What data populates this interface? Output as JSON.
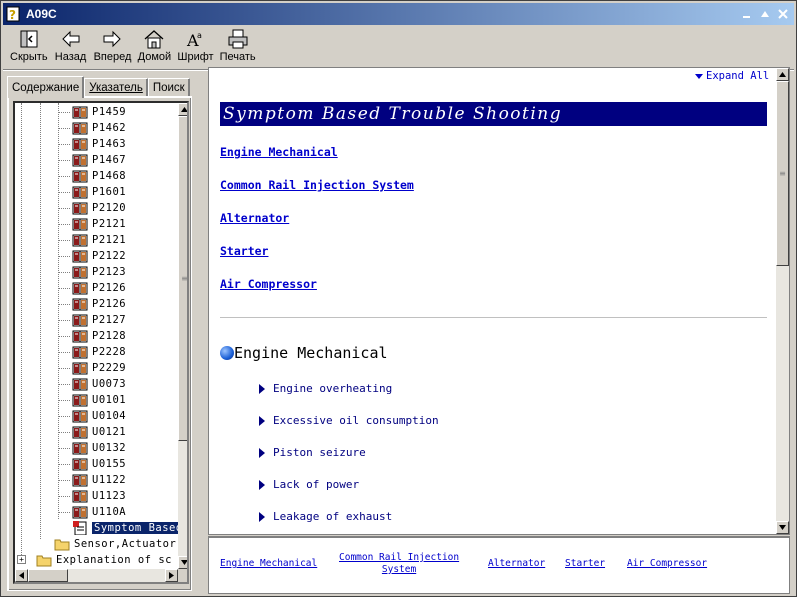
{
  "window": {
    "title": "A09C"
  },
  "toolbar": {
    "buttons": [
      {
        "label": "Скрыть",
        "icon": "hide-icon"
      },
      {
        "label": "Назад",
        "icon": "back-arrow-icon"
      },
      {
        "label": "Вперед",
        "icon": "forward-arrow-icon"
      },
      {
        "label": "Домой",
        "icon": "home-icon"
      },
      {
        "label": "Шрифт",
        "icon": "font-icon"
      },
      {
        "label": "Печать",
        "icon": "printer-icon"
      }
    ]
  },
  "tabs": [
    {
      "label": "Содержание",
      "active": true
    },
    {
      "label": "Указатель",
      "active": false
    },
    {
      "label": "Поиск",
      "active": false
    }
  ],
  "tree": {
    "codes": [
      "P1459",
      "P1462",
      "P1463",
      "P1467",
      "P1468",
      "P1601",
      "P2120",
      "P2121",
      "P2121",
      "P2122",
      "P2123",
      "P2126",
      "P2126",
      "P2127",
      "P2128",
      "P2228",
      "P2229",
      "U0073",
      "U0101",
      "U0104",
      "U0121",
      "U0132",
      "U0155",
      "U1122",
      "U1123",
      "U110A"
    ],
    "selected": "Symptom Based",
    "folder1": "Sensor,Actuator",
    "folder2": "Explanation of sc"
  },
  "content": {
    "expand_all": "Expand All",
    "title": "Symptom Based Trouble Shooting",
    "toc": [
      "Engine Mechanical",
      "Common Rail Injection System",
      "Alternator",
      "Starter",
      "Air Compressor"
    ],
    "section_title": "Engine Mechanical",
    "section_items": [
      "Engine overheating",
      "Excessive oil consumption",
      "Piston seizure",
      "Lack of power",
      "Leakage of exhaust"
    ]
  },
  "bottom_nav": {
    "engine": "Engine Mechanical",
    "common_rail_1": "Common Rail Injection",
    "common_rail_2": "System",
    "alternator": "Alternator",
    "starter": "Starter",
    "air": "Air Compressor"
  },
  "colors": {
    "title_bar": "#0a246a",
    "page_title_bg": "#000080",
    "link": "#0000cc",
    "selection": "#0a246a"
  }
}
